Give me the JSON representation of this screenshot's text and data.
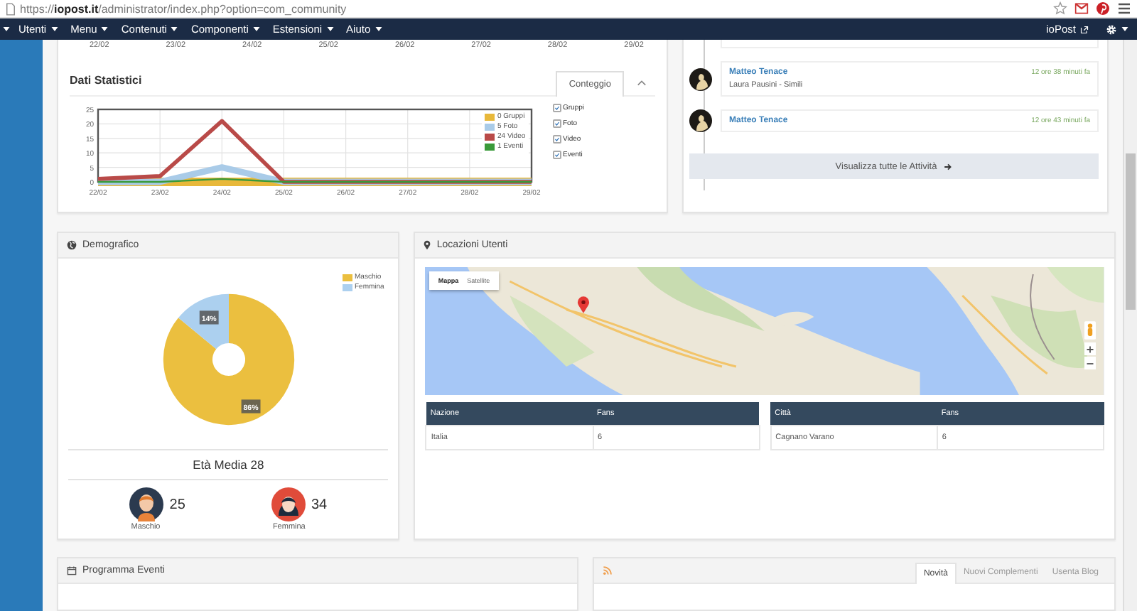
{
  "browser": {
    "url": "https://**iopost.it**/administrator/index.php?option=com_community"
  },
  "navbar": {
    "items": [
      {
        "label": "Utenti"
      },
      {
        "label": "Menu"
      },
      {
        "label": "Contenuti"
      },
      {
        "label": "Componenti"
      },
      {
        "label": "Estensioni"
      },
      {
        "label": "Aiuto"
      }
    ],
    "site_link": "ioPost"
  },
  "upper_chart_axis": [
    "22/02",
    "23/02",
    "24/02",
    "25/02",
    "26/02",
    "27/02",
    "28/02",
    "29/02"
  ],
  "stats": {
    "title": "Dati Statistici",
    "tabs": [
      {
        "label": "Conteggio",
        "selected": true
      }
    ],
    "chart_data": {
      "type": "line",
      "grid": true,
      "categories": [
        "22/02",
        "23/02",
        "24/02",
        "25/02",
        "26/02",
        "27/02",
        "28/02",
        "29/02"
      ],
      "ylim": [
        0,
        25
      ],
      "yticks": [
        0,
        5,
        10,
        15,
        20,
        25
      ],
      "series": [
        {
          "name": "Gruppi",
          "color": "#e8b83a",
          "values": [
            0,
            0,
            0,
            0,
            0,
            0,
            0,
            0
          ]
        },
        {
          "name": "Foto",
          "color": "#a9cbe8",
          "values": [
            0,
            0,
            5,
            0,
            0,
            0,
            0,
            0
          ]
        },
        {
          "name": "Video",
          "color": "#b94a48",
          "values": [
            1,
            2,
            21,
            0,
            0,
            0,
            0,
            0
          ]
        },
        {
          "name": "Eventi",
          "color": "#3a9a3a",
          "values": [
            0,
            0,
            1,
            0,
            0,
            0,
            0,
            0
          ]
        }
      ]
    },
    "legend": [
      "0 Gruppi",
      "5 Foto",
      "24 Video",
      "1 Eventi"
    ],
    "toggles": [
      {
        "checked": true
      },
      {
        "checked": true
      },
      {
        "checked": true
      },
      {
        "checked": true
      }
    ]
  },
  "activity": {
    "items": [
      {
        "name": "Matteo Tenace",
        "text": "Laura Pausini - Simili",
        "time": "12 ore 38 minuti fa"
      },
      {
        "name": "Matteo Tenace",
        "time": "12 ore 43 minuti fa"
      }
    ],
    "button": "Visualizza tutte le Attività"
  },
  "demographics": {
    "title": "Demografico",
    "legend": [
      {
        "color": "#ebbf3f"
      },
      {
        "color": "#acd0ef"
      }
    ],
    "chart_data": {
      "type": "donut",
      "categories": [
        "Maschio",
        "Femmina"
      ],
      "values": [
        86,
        14
      ],
      "value_labels": [
        "86%",
        "14%"
      ]
    },
    "average": "Età Media 28",
    "genders": [
      {
        "kind": "male",
        "count": "25",
        "label": "Maschio"
      },
      {
        "kind": "female",
        "count": "34",
        "label": "Femmina"
      }
    ]
  },
  "locations": {
    "title": "Locazioni Utenti",
    "map": {
      "kind": "picture",
      "map_types": [
        {
          "label": "Mappa",
          "selected": true
        },
        {
          "label": "Satellite",
          "selected": false
        }
      ]
    },
    "tables": [
      {
        "columns": [
          "Nazione",
          "Fans"
        ],
        "rows": [
          [
            "Italia",
            "6"
          ]
        ]
      },
      {
        "columns": [
          "Città",
          "Fans"
        ],
        "rows": [
          [
            "Cagnano Varano",
            "6"
          ]
        ]
      }
    ]
  },
  "events": {
    "title": "Programma Eventi"
  },
  "news": {
    "tabs": [
      {
        "label": "Novità",
        "selected": true
      },
      {
        "label": "Nuovi Complementi",
        "selected": false
      },
      {
        "label": "Usenta Blog",
        "selected": false
      }
    ]
  }
}
